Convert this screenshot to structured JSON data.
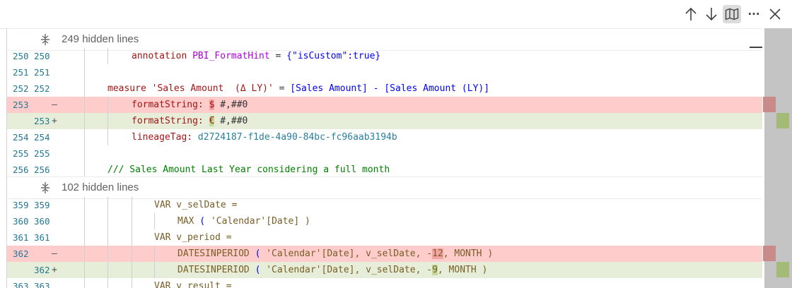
{
  "toolbar": {
    "buttons": [
      "previous-change",
      "next-change",
      "minimap-toggle",
      "more-actions",
      "close"
    ],
    "more_label": "···"
  },
  "hidden": [
    {
      "label": "249 hidden lines"
    },
    {
      "label": "102 hidden lines"
    }
  ],
  "lines": [
    {
      "orig": "250",
      "mod": "250",
      "type": "context"
    },
    {
      "orig": "251",
      "mod": "251",
      "type": "context"
    },
    {
      "orig": "252",
      "mod": "252",
      "type": "context"
    },
    {
      "orig": "253",
      "mod": "",
      "type": "removed",
      "mark": "—"
    },
    {
      "orig": "",
      "mod": "253",
      "type": "added",
      "mark": "+"
    },
    {
      "orig": "254",
      "mod": "254",
      "type": "context"
    },
    {
      "orig": "255",
      "mod": "255",
      "type": "context"
    },
    {
      "orig": "256",
      "mod": "256",
      "type": "context"
    },
    {
      "orig": "359",
      "mod": "359",
      "type": "context"
    },
    {
      "orig": "360",
      "mod": "360",
      "type": "context"
    },
    {
      "orig": "361",
      "mod": "361",
      "type": "context"
    },
    {
      "orig": "362",
      "mod": "",
      "type": "removed",
      "mark": "—"
    },
    {
      "orig": "",
      "mod": "362",
      "type": "added",
      "mark": "+"
    },
    {
      "orig": "363",
      "mod": "363",
      "type": "context"
    }
  ],
  "code": {
    "l250": {
      "kw": "annotation",
      "name": "PBI_FormatHint",
      "eq": " = ",
      "val": "{\"isCustom\":true}"
    },
    "l252": {
      "kw": "measure",
      "name": "'Sales Amount  (Δ LY)'",
      "eq": " = ",
      "expr": "[Sales Amount] - [Sales Amount (LY)]"
    },
    "l253_removed": {
      "key": "formatString:",
      "sp": " ",
      "sym": "$",
      "rest": " #,##0"
    },
    "l253_added": {
      "key": "formatString:",
      "sp": " ",
      "sym": "€",
      "rest": " #,##0"
    },
    "l254": {
      "key": "lineageTag:",
      "val": " d2724187-f1de-4a90-84bc-fc96aab3194b"
    },
    "l256": {
      "comment": "/// Sales Amount Last Year considering a full month"
    },
    "l359": {
      "kw": "VAR",
      "rest": " v_selDate ="
    },
    "l360": {
      "fn": "MAX",
      "rest1": " ( ",
      "str": "'Calendar'",
      "rest2": "[Date] )"
    },
    "l361": {
      "kw": "VAR",
      "rest": " v_period ="
    },
    "l362_removed": {
      "fn": "DATESINPERIOD",
      "a": " ( ",
      "str": "'Calendar'",
      "b": "[Date], v_selDate, ",
      "minus": "-",
      "num": "12",
      "c": ", MONTH )"
    },
    "l362_added": {
      "fn": "DATESINPERIOD",
      "a": " ( ",
      "str": "'Calendar'",
      "b": "[Date], v_selDate, ",
      "minus": "-",
      "num": "9",
      "c": ", MONTH )"
    },
    "l363": {
      "kw": "VAR",
      "rest": " v_result ="
    }
  },
  "colors": {
    "removed_line": "#ffcccc",
    "added_line": "#e6eed9",
    "removed_char": "#f4a3a3",
    "added_char": "#c3da99",
    "minimap_removed": "#c98a8a",
    "minimap_added": "#a3bb76"
  }
}
